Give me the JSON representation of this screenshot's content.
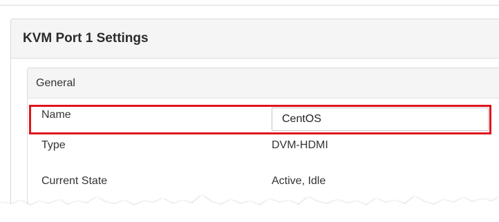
{
  "panel": {
    "title": "KVM Port 1 Settings"
  },
  "general": {
    "title": "General",
    "rows": [
      {
        "label": "Name",
        "value": "CentOS",
        "editable": true
      },
      {
        "label": "Type",
        "value": "DVM-HDMI",
        "editable": false
      },
      {
        "label": "Current State",
        "value": "Active, Idle",
        "editable": false
      }
    ]
  },
  "colors": {
    "highlight": "#e0141c",
    "header_bg": "#f5f5f5",
    "border": "#d8d8d8"
  }
}
